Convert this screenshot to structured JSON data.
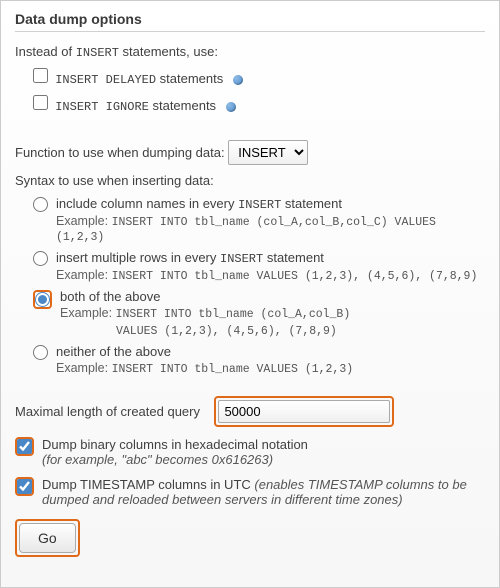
{
  "title": "Data dump options",
  "intro_before": "Instead of ",
  "intro_code": "INSERT",
  "intro_after": " statements, use:",
  "sub1_code": "INSERT DELAYED",
  "sub1_after": " statements",
  "sub2_code": "INSERT IGNORE",
  "sub2_after": " statements",
  "function_label": "Function to use when dumping data: ",
  "function_selected": "INSERT",
  "syntax_label": "Syntax to use when inserting data:",
  "opt1_before": "include column names in every ",
  "opt1_code": "INSERT",
  "opt1_after": " statement",
  "ex_prefix": "Example: ",
  "ex1_code": "INSERT INTO tbl_name (col_A,col_B,col_C) VALUES (1,2,3)",
  "opt2_before": "insert multiple rows in every ",
  "opt2_code": "INSERT",
  "opt2_after": " statement",
  "ex2_code": "INSERT INTO tbl_name VALUES (1,2,3), (4,5,6), (7,8,9)",
  "opt3": "both of the above",
  "ex3a_code": "INSERT INTO tbl_name (col_A,col_B)",
  "ex3b_code": "VALUES (1,2,3), (4,5,6), (7,8,9)",
  "opt4": "neither of the above",
  "ex4_code": "INSERT INTO tbl_name VALUES (1,2,3)",
  "maxlen_label": "Maximal length of created query",
  "maxlen_value": "50000",
  "dump_hex": "Dump binary columns in hexadecimal notation",
  "dump_hex_note": "(for example, \"abc\" becomes 0x616263)",
  "dump_utc_before": "Dump TIMESTAMP columns in UTC ",
  "dump_utc_note": "(enables TIMESTAMP columns to be dumped and reloaded between servers in different time zones)",
  "go_label": "Go"
}
